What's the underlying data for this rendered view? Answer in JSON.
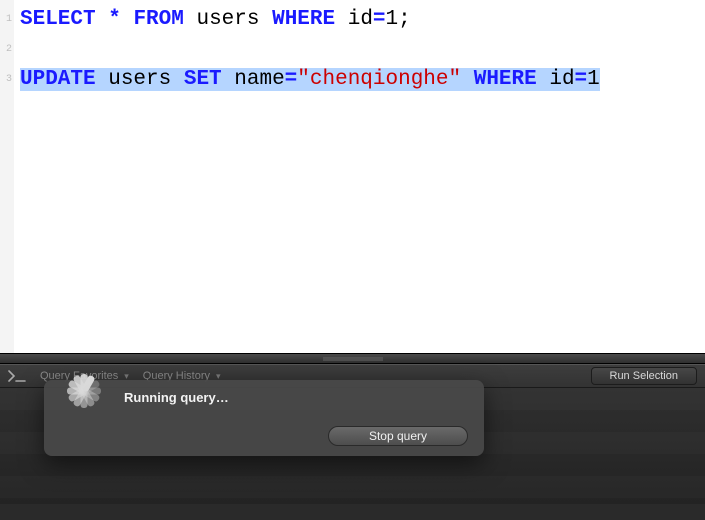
{
  "editor": {
    "lines": [
      {
        "n": 1,
        "selected": false,
        "tokens": [
          {
            "t": "SELECT",
            "c": "kw"
          },
          {
            "t": " ",
            "c": "ident"
          },
          {
            "t": "*",
            "c": "op"
          },
          {
            "t": " ",
            "c": "ident"
          },
          {
            "t": "FROM",
            "c": "kw"
          },
          {
            "t": " users ",
            "c": "ident"
          },
          {
            "t": "WHERE",
            "c": "kw"
          },
          {
            "t": " id",
            "c": "ident"
          },
          {
            "t": "=",
            "c": "op"
          },
          {
            "t": "1",
            "c": "ident"
          },
          {
            "t": ";",
            "c": "punct"
          }
        ]
      },
      {
        "n": 2,
        "selected": false,
        "tokens": []
      },
      {
        "n": 3,
        "selected": true,
        "tokens": [
          {
            "t": "UPDATE",
            "c": "kw"
          },
          {
            "t": " users ",
            "c": "ident"
          },
          {
            "t": "SET",
            "c": "kw"
          },
          {
            "t": " name",
            "c": "ident"
          },
          {
            "t": "=",
            "c": "op"
          },
          {
            "t": "\"chenqionghe\"",
            "c": "str"
          },
          {
            "t": " ",
            "c": "ident"
          },
          {
            "t": "WHERE",
            "c": "kw"
          },
          {
            "t": " id",
            "c": "ident"
          },
          {
            "t": "=",
            "c": "op"
          },
          {
            "t": "1",
            "c": "ident"
          }
        ]
      }
    ]
  },
  "toolbar": {
    "favorites_label": "Query Favorites",
    "history_label": "Query History",
    "run_label": "Run Selection"
  },
  "popup": {
    "message": "Running query…",
    "stop_label": "Stop query"
  }
}
